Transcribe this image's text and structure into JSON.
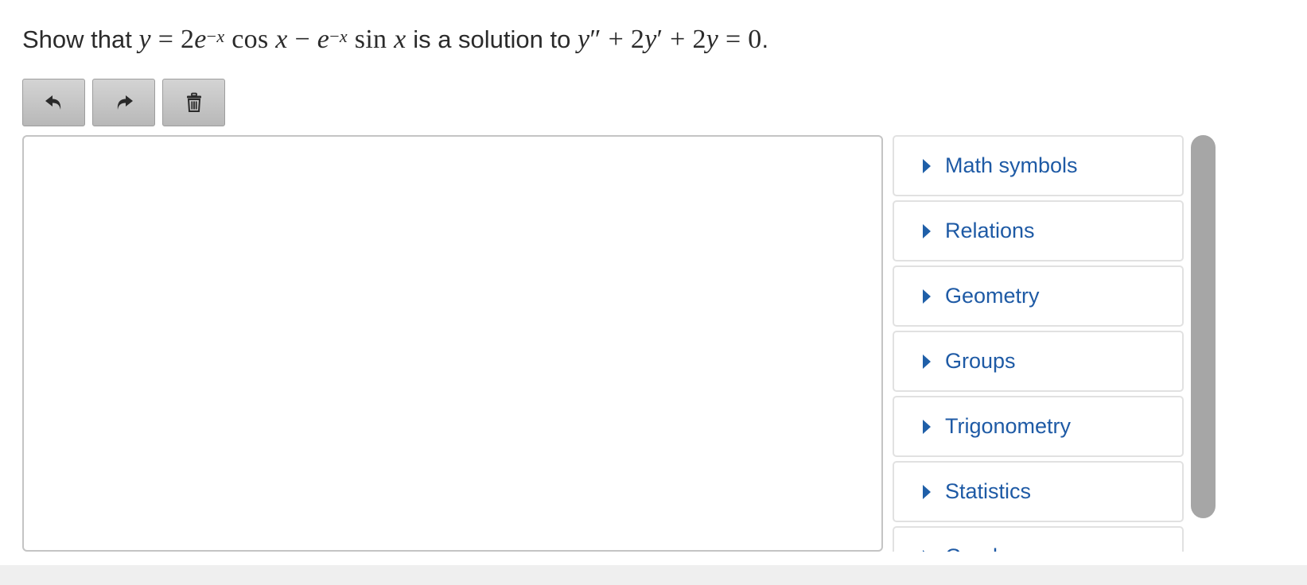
{
  "prompt": {
    "before": "Show that ",
    "middle": " is a solution to ",
    "end": "."
  },
  "toolbar": {
    "undo_icon": "undo-arrow-icon",
    "redo_icon": "redo-arrow-icon",
    "clear_icon": "trash-icon"
  },
  "palette": {
    "items": [
      {
        "label": "Math symbols"
      },
      {
        "label": "Relations"
      },
      {
        "label": "Geometry"
      },
      {
        "label": "Groups"
      },
      {
        "label": "Trigonometry"
      },
      {
        "label": "Statistics"
      },
      {
        "label": "Greek"
      }
    ]
  },
  "colors": {
    "link_blue": "#1e5aa5",
    "button_grey": "#c6c6c6",
    "scrollbar": "#a6a6a6"
  }
}
